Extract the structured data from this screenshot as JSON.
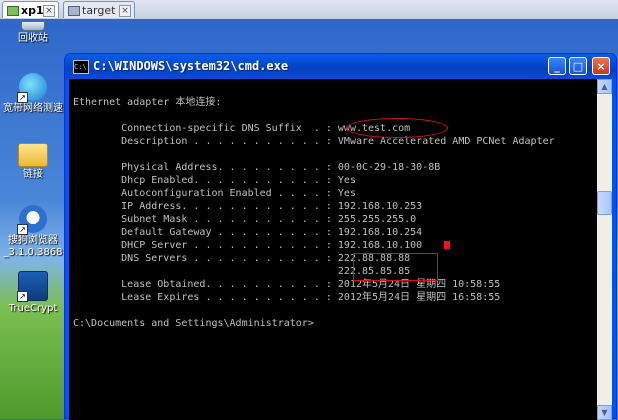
{
  "vm_tabs": [
    {
      "label": "xp1",
      "active": true
    },
    {
      "label": "target",
      "active": false
    }
  ],
  "desktop_icons": [
    {
      "label": "回收站",
      "icon": "recycle-bin-icon"
    },
    {
      "label": "宽带网络测速",
      "icon": "ie-shortcut-icon"
    },
    {
      "label": "链接",
      "icon": "folder-icon"
    },
    {
      "label": "搜狗浏览器",
      "label2": "_3.1.0.3868",
      "icon": "sogou-browser-icon"
    },
    {
      "label": "TrueCrypt",
      "icon": "truecrypt-icon"
    }
  ],
  "cmd": {
    "title": "C:\\WINDOWS\\system32\\cmd.exe",
    "icon_text": "C:\\",
    "lines": [
      "Ethernet adapter 本地连接:",
      "",
      "        Connection-specific DNS Suffix  . : www.test.com",
      "        Description . . . . . . . . . . . : VMware Accelerated AMD PCNet Adapter",
      "",
      "        Physical Address. . . . . . . . . : 00-0C-29-18-30-8B",
      "        Dhcp Enabled. . . . . . . . . . . : Yes",
      "        Autoconfiguration Enabled . . . . : Yes",
      "        IP Address. . . . . . . . . . . . : 192.168.10.253",
      "        Subnet Mask . . . . . . . . . . . : 255.255.255.0",
      "        Default Gateway . . . . . . . . . : 192.168.10.254",
      "        DHCP Server . . . . . . . . . . . : 192.168.10.100",
      "        DNS Servers . . . . . . . . . . . : 222.88.88.88",
      "                                            222.85.85.85",
      "        Lease Obtained. . . . . . . . . . : 2012年5月24日 星期四 10:58:55",
      "        Lease Expires . . . . . . . . . . : 2012年5月24日 星期四 16:58:55",
      "",
      "C:\\Documents and Settings\\Administrator>"
    ]
  },
  "colors": {
    "annotation": "#e01010",
    "console_text": "#c0c0c0",
    "console_bg": "#000000"
  }
}
